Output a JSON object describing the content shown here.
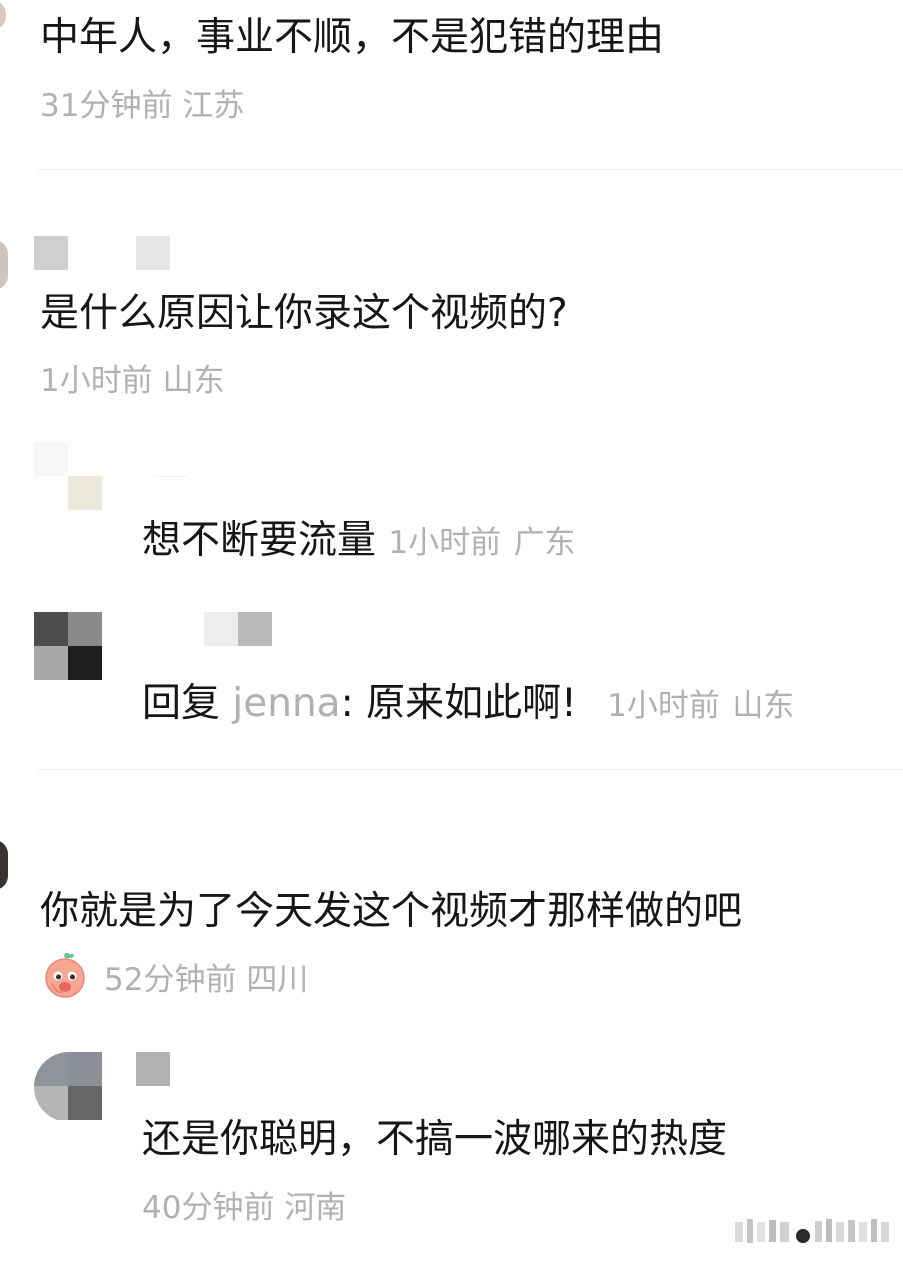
{
  "comments": [
    {
      "text": "中年人，事业不顺，不是犯错的理由",
      "time": "31分钟前",
      "location": "江苏"
    },
    {
      "text": "是什么原因让你录这个视频的?",
      "time": "1小时前",
      "location": "山东",
      "replies": [
        {
          "text": "想不断要流量",
          "time": "1小时前",
          "location": "广东"
        },
        {
          "prefix": "回复",
          "reply_to": "jenna",
          "text": ": 原来如此啊!",
          "time": "1小时前",
          "location": "山东"
        }
      ]
    },
    {
      "text": "你就是为了今天发这个视频才那样做的吧",
      "time": "52分钟前",
      "location": "四川",
      "badge_icon": "peach-emoji-icon",
      "replies": [
        {
          "text": "还是你聪明，不搞一波哪来的热度",
          "time": "40分钟前",
          "location": "河南"
        }
      ]
    }
  ]
}
